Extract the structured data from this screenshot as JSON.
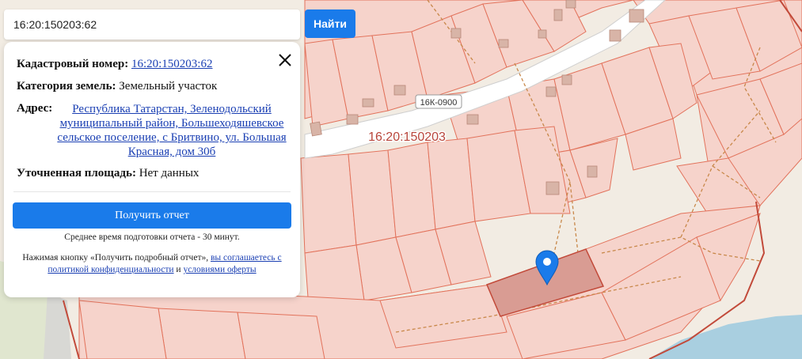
{
  "search": {
    "value": "16:20:150203:62",
    "button_label": "Найти"
  },
  "map": {
    "road_label": "16К-0900",
    "quarter_label": "16:20:150203"
  },
  "info_panel": {
    "cadastral_label": "Кадастровый номер:",
    "cadastral_value": "16:20:150203:62",
    "category_label": "Категория земель:",
    "category_value": "Земельный участок",
    "address_label": "Адрес:",
    "address_value": "Республика Татарстан, Зеленодольский муниципальный район, Большеходяшевское сельское поселение, с Бритвино, ул. Большая Красная, дом 30б",
    "area_label": "Уточненная площадь:",
    "area_value": "Нет данных",
    "report_button_label": "Получить отчет",
    "avg_time_text": "Среднее время подготовки отчета - 30 минут.",
    "consent_prefix": "Нажимая кнопку «Получить подробный отчет»,",
    "consent_link1": "вы соглашаетесь с политикой конфиденциальности",
    "consent_and": "и",
    "consent_link2": "условиями оферты"
  },
  "colors": {
    "accent": "#1a7bea",
    "parcel_fill": "#f6d3cb",
    "parcel_stroke": "#e2725b",
    "selected_parcel": "#d99c93",
    "water": "#a9cfe0",
    "marker": "#1a7bea"
  },
  "icons": {
    "close": "close-icon",
    "marker": "location-pin-icon"
  }
}
